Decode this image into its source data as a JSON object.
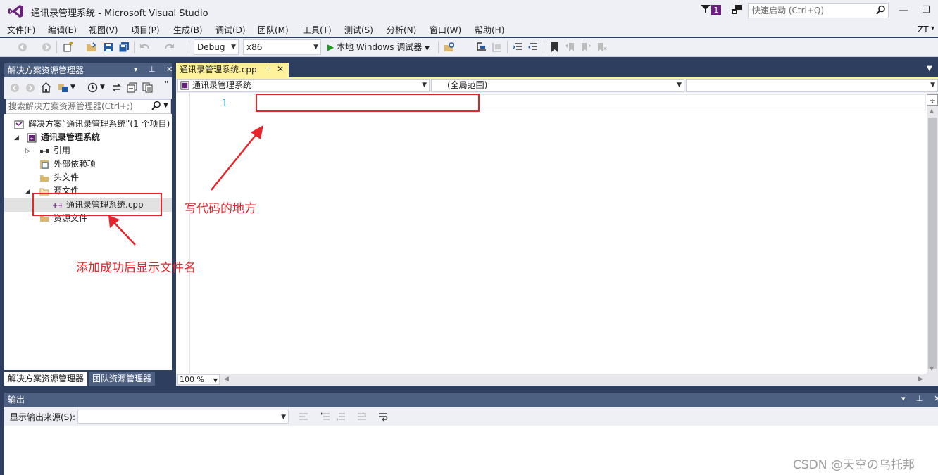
{
  "window": {
    "title": "通讯录管理系统 - Microsoft Visual Studio",
    "notification_count": "1",
    "quick_launch_placeholder": "快速启动 (Ctrl+Q)",
    "minimize_glyph": "—",
    "maximize_glyph": "❐"
  },
  "menu": {
    "items": [
      "文件(F)",
      "编辑(E)",
      "视图(V)",
      "项目(P)",
      "生成(B)",
      "调试(D)",
      "团队(M)",
      "工具(T)",
      "测试(S)",
      "分析(N)",
      "窗口(W)",
      "帮助(H)"
    ],
    "user_initials": "ZT"
  },
  "toolbar": {
    "config": "Debug",
    "platform": "x86",
    "start_debugger": "本地 Windows 调试器"
  },
  "solution_explorer": {
    "title": "解决方案资源管理器",
    "search_placeholder": "搜索解决方案资源管理器(Ctrl+;)",
    "solution": "解决方案“通讯录管理系统”(1 个项目)",
    "project": "通讯录管理系统",
    "nodes": {
      "references": "引用",
      "external_deps": "外部依赖项",
      "header_files": "头文件",
      "source_files": "源文件",
      "source_file": "通讯录管理系统.cpp",
      "resource_files": "资源文件"
    },
    "tabs": [
      "解决方案资源管理器",
      "团队资源管理器"
    ]
  },
  "editor": {
    "tab_title": "通讯录管理系统.cpp",
    "nav_project": "通讯录管理系统",
    "nav_scope": "(全局范围)",
    "line_number": "1",
    "zoom": "100 %"
  },
  "output": {
    "title": "输出",
    "source_label": "显示输出来源(S):"
  },
  "annotations": {
    "code_area": "写代码的地方",
    "file_added": "添加成功后显示文件名"
  },
  "watermark": "CSDN @天空の乌托邦",
  "colors": {
    "accent": "#68217a",
    "header_bg": "#4d6082",
    "frame_bg": "#2d3e5e",
    "active_tab": "#fff29d",
    "annotation_red": "#e8242b"
  }
}
